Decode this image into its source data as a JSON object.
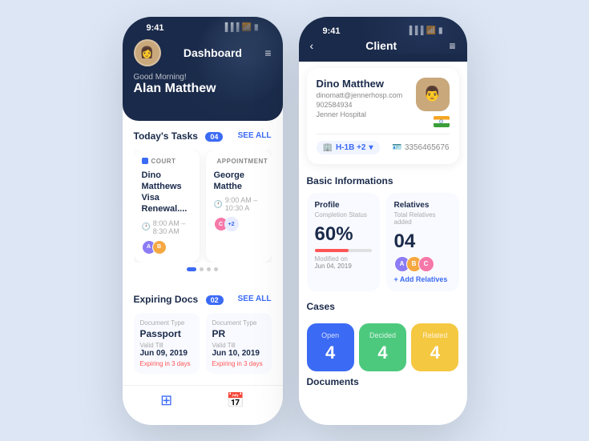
{
  "leftPhone": {
    "statusBar": {
      "time": "9:41",
      "title": "Dashboard"
    },
    "greeting": "Good Morning!",
    "userName": "Alan Matthew",
    "todaysTasks": {
      "label": "Today's Tasks",
      "count": "04",
      "seeAll": "SEE ALL",
      "tasks": [
        {
          "type": "COURT",
          "dotColor": "blue",
          "name": "Dino Matthews Visa Renewal....",
          "time": "8:00 AM – 8:30 AM"
        },
        {
          "type": "APPOINTMENT",
          "dotColor": "yellow",
          "name": "George Matthe",
          "time": "9:00 AM – 10:30 A"
        }
      ]
    },
    "expiringDocs": {
      "label": "Expiring Docs",
      "count": "02",
      "seeAll": "SEE ALL",
      "docs": [
        {
          "typeLabel": "Document Type",
          "name": "Passport",
          "validLabel": "Valid Till",
          "validDate": "Jun 09, 2019",
          "expiry": "Expiring in 3 days"
        },
        {
          "typeLabel": "Document Type",
          "name": "PR",
          "validLabel": "Valid Till",
          "validDate": "Jun 10, 2019",
          "expiry": "Expiring in 3 days"
        }
      ]
    }
  },
  "rightPhone": {
    "statusBar": {
      "time": "9:41",
      "title": "Client"
    },
    "client": {
      "name": "Dino Matthew",
      "email": "dinomatt@jennerhosp.com",
      "phone": "902584934",
      "company": "Jenner Hospital",
      "visa": "H-1B +2",
      "id": "3356465676"
    },
    "basicInformations": {
      "title": "Basic Informations",
      "profile": {
        "title": "Profile",
        "subtitle": "Completion Status",
        "percent": "60%",
        "progressValue": 60,
        "modifiedLabel": "Modified on",
        "modifiedDate": "Jun 04, 2019"
      },
      "relatives": {
        "title": "Relatives",
        "subtitle": "Total Relatives added",
        "count": "04",
        "addLabel": "+ Add Relatives"
      }
    },
    "cases": {
      "title": "Cases",
      "items": [
        {
          "label": "Open",
          "count": "4",
          "color": "open"
        },
        {
          "label": "Decided",
          "count": "4",
          "color": "decided"
        },
        {
          "label": "Related",
          "count": "4",
          "color": "related"
        }
      ]
    },
    "documents": {
      "title": "Documents"
    }
  }
}
